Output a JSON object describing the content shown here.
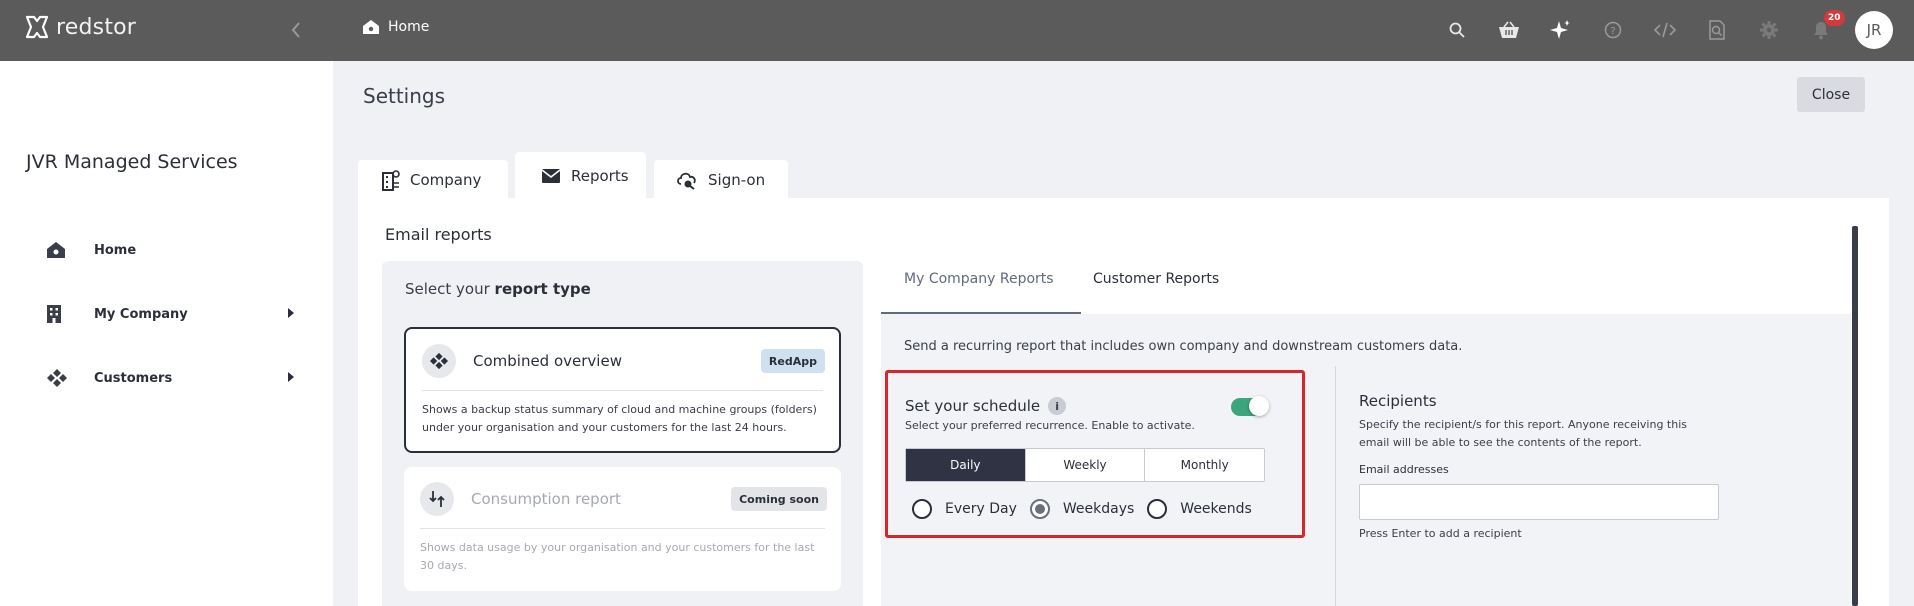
{
  "brand": {
    "name": "redstor"
  },
  "topbar": {
    "breadcrumb": "Home",
    "icons": [
      "search-icon",
      "basket-icon",
      "sparkle-icon",
      "help-icon",
      "code-icon",
      "search-document-icon",
      "gear-icon",
      "bell-icon"
    ],
    "notifications_count": "20",
    "avatar_initials": "JR"
  },
  "sidebar": {
    "org_name": "JVR Managed Services",
    "items": [
      {
        "label": "Home",
        "icon": "home-icon",
        "has_children": false
      },
      {
        "label": "My Company",
        "icon": "building-icon",
        "has_children": true
      },
      {
        "label": "Customers",
        "icon": "customers-icon",
        "has_children": true
      }
    ]
  },
  "page": {
    "title": "Settings",
    "close_label": "Close",
    "tabs": [
      {
        "label": "Company",
        "icon": "company-icon",
        "active": false
      },
      {
        "label": "Reports",
        "icon": "envelope-icon",
        "active": true
      },
      {
        "label": "Sign-on",
        "icon": "cloud-key-icon",
        "active": false
      }
    ]
  },
  "reports": {
    "section_title": "Email reports",
    "select_prefix": "Select your ",
    "select_bold": "report type",
    "cards": [
      {
        "title": "Combined overview",
        "badge": "RedApp",
        "desc": "Shows a backup status summary of cloud and machine groups (folders) under your organisation and your customers for the last 24 hours.",
        "active": true
      },
      {
        "title": "Consumption report",
        "badge": "Coming soon",
        "desc": "Shows data usage by your organisation and your customers for the last 30 days.",
        "active": false
      }
    ],
    "subtabs": [
      {
        "label": "My Company Reports",
        "active": true
      },
      {
        "label": "Customer Reports",
        "active": false
      }
    ],
    "description": "Send a recurring report that includes own company and downstream customers data.",
    "schedule": {
      "title": "Set your schedule",
      "info": "i",
      "subtitle": "Select your preferred recurrence. Enable to activate.",
      "enabled": true,
      "options": [
        "Daily",
        "Weekly",
        "Monthly"
      ],
      "selected": "Daily",
      "days": [
        {
          "label": "Every Day",
          "checked": false
        },
        {
          "label": "Weekdays",
          "checked": true
        },
        {
          "label": "Weekends",
          "checked": false
        }
      ]
    },
    "recipients": {
      "title": "Recipients",
      "desc": "Specify the recipient/s for this report. Anyone receiving this email will be able to see the contents of the report.",
      "label": "Email addresses",
      "value": "",
      "hint": "Press Enter to add a recipient"
    }
  },
  "colors": {
    "topbar": "#5b5b5b",
    "accent_dark": "#2f3344",
    "toggle_on": "#3ba67a",
    "highlight": "#d6262b",
    "badge_red": "#d33a3a"
  }
}
